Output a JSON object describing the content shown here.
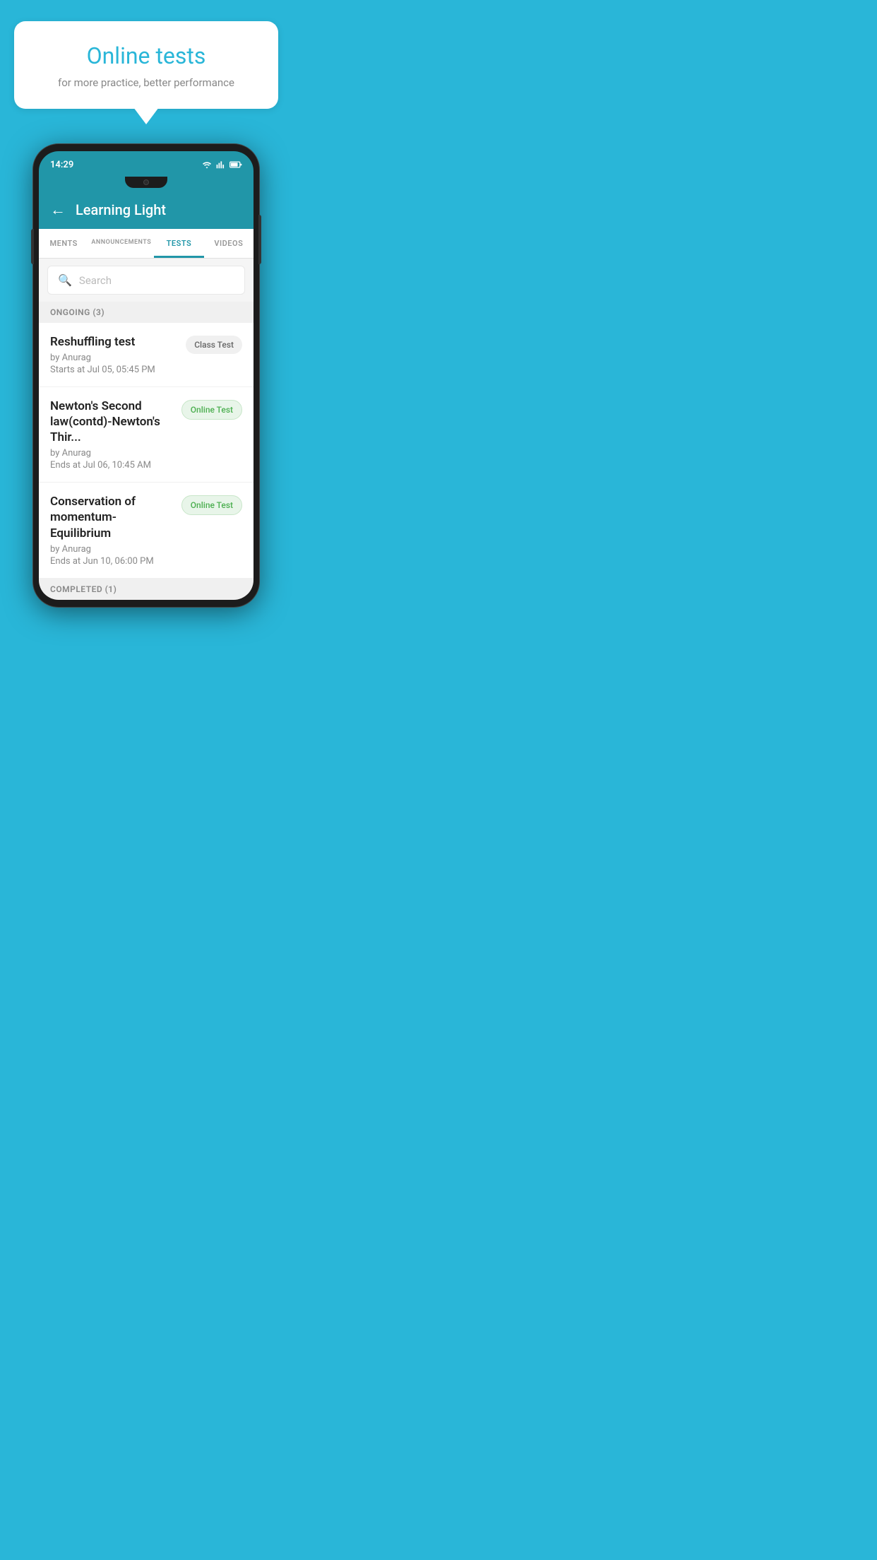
{
  "background_color": "#29B6D8",
  "speech_bubble": {
    "title": "Online tests",
    "subtitle": "for more practice, better performance"
  },
  "phone": {
    "status_bar": {
      "time": "14:29"
    },
    "app_header": {
      "title": "Learning Light",
      "back_label": "←"
    },
    "tabs": [
      {
        "label": "MENTS",
        "active": false
      },
      {
        "label": "ANNOUNCEMENTS",
        "active": false
      },
      {
        "label": "TESTS",
        "active": true
      },
      {
        "label": "VIDEOS",
        "active": false
      }
    ],
    "search": {
      "placeholder": "Search"
    },
    "sections": [
      {
        "header": "ONGOING (3)",
        "items": [
          {
            "title": "Reshuffling test",
            "by": "by Anurag",
            "date": "Starts at  Jul 05, 05:45 PM",
            "badge": "Class Test",
            "badge_type": "class-test"
          },
          {
            "title": "Newton's Second law(contd)-Newton's Thir...",
            "by": "by Anurag",
            "date": "Ends at  Jul 06, 10:45 AM",
            "badge": "Online Test",
            "badge_type": "online-test"
          },
          {
            "title": "Conservation of momentum-Equilibrium",
            "by": "by Anurag",
            "date": "Ends at  Jun 10, 06:00 PM",
            "badge": "Online Test",
            "badge_type": "online-test"
          }
        ]
      },
      {
        "header": "COMPLETED (1)",
        "items": []
      }
    ]
  }
}
